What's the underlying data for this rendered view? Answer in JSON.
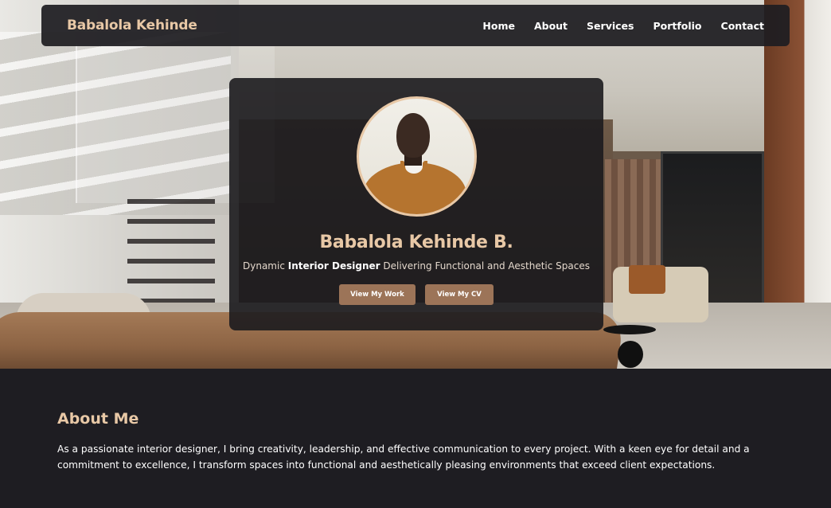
{
  "nav": {
    "brand": "Babalola Kehinde",
    "links": [
      "Home",
      "About",
      "Services",
      "Portfolio",
      "Contact"
    ]
  },
  "hero": {
    "name": "Babalola Kehinde B.",
    "tagline_prefix": "Dynamic ",
    "tagline_bold": "Interior Designer",
    "tagline_suffix": " Delivering Functional and Aesthetic Spaces",
    "buttons": {
      "work": "View My Work",
      "cv": "View My CV"
    }
  },
  "about": {
    "title": "About Me",
    "body": "As a passionate interior designer, I bring creativity, leadership, and effective communication to every project. With a keen eye for detail and a commitment to excellence, I transform spaces into functional and aesthetically pleasing environments that exceed client expectations."
  },
  "colors": {
    "accent": "#e8c8a6",
    "button": "#9c7458",
    "background": "#1e1d22",
    "card": "#1c1b1e"
  }
}
